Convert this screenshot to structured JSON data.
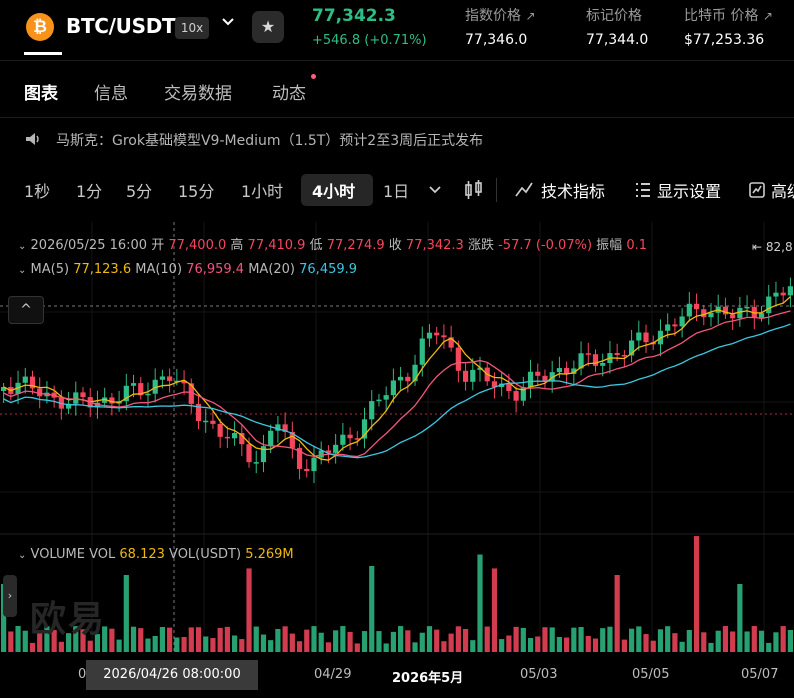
{
  "header": {
    "coin_symbol": "₿",
    "pair": "BTC/USDT",
    "leverage": "10x",
    "last_price": "77,342.3",
    "change": "+546.8 (+0.71%)",
    "index_label": "指数价格",
    "index_value": "77,346.0",
    "mark_label": "标记价格",
    "mark_value": "77,344.0",
    "btc_label": "比特币 价格",
    "btc_value": "$77,253.36"
  },
  "tabs": [
    "图表",
    "信息",
    "交易数据",
    "动态"
  ],
  "news": "马斯克：Grok基础模型V9-Medium（1.5T）预计2至3周后正式发布",
  "timeframes": [
    "1秒",
    "1分",
    "5分",
    "15分",
    "1小时",
    "4小时",
    "1日"
  ],
  "tools": {
    "indicators": "技术指标",
    "display": "显示设置",
    "more": "高级"
  },
  "ohlc": {
    "date": "2026/05/25 16:00",
    "open_l": "开",
    "open": "77,400.0",
    "high_l": "高",
    "high": "77,410.9",
    "low_l": "低",
    "low": "77,274.9",
    "close_l": "收",
    "close": "77,342.3",
    "chg_l": "涨跌",
    "chg": "-57.7 (-0.07%)",
    "amp_l": "振幅",
    "amp": "0.1"
  },
  "ma": {
    "ma5_l": "MA(5)",
    "ma5": "77,123.6",
    "ma10_l": "MA(10)",
    "ma10": "76,959.4",
    "ma20_l": "MA(20)",
    "ma20": "76,459.9"
  },
  "volume": {
    "title": "VOLUME",
    "vol_l": "VOL",
    "vol": "68.123",
    "volu_l": "VOL(USDT)",
    "volu": "5.269M"
  },
  "price_tag": "82,8",
  "watermark": "欧易",
  "xaxis": {
    "hover": "2026/04/26 08:00:00",
    "cut": "0",
    "labels": [
      "04/29",
      "2026年5月",
      "05/03",
      "05/05",
      "05/07"
    ]
  },
  "colors": {
    "up": "#2ebd85",
    "down": "#f6465d",
    "ma5": "#f0b90b",
    "ma10": "#f2557a",
    "ma20": "#3cc6e0"
  }
}
